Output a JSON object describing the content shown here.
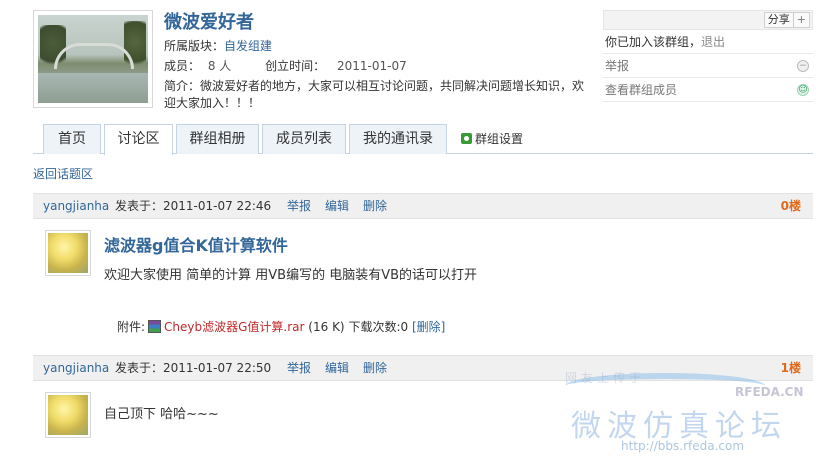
{
  "group": {
    "title": "微波爱好者",
    "section_label": "所属版块：",
    "section_value": "自发组建",
    "members_label": "成员：",
    "members_value": "8 人",
    "created_label": "创立时间：",
    "created_value": "2011-01-07",
    "intro": "简介：微波爱好者的地方，大家可以相互讨论问题，共同解决问题增长知识，欢迎大家加入！！！"
  },
  "sidebar": {
    "share_label": "分享",
    "share_plus": "+",
    "joined_text": "你已加入该群组，",
    "exit_label": "退出",
    "report_label": "举报",
    "view_members_label": "查看群组成员"
  },
  "tabs": [
    {
      "label": "首页"
    },
    {
      "label": "讨论区"
    },
    {
      "label": "群组相册"
    },
    {
      "label": "成员列表"
    },
    {
      "label": "我的通讯录"
    }
  ],
  "tab_settings_label": "群组设置",
  "back_link": "返回话题区",
  "posts": [
    {
      "author": "yangjianha",
      "meta": "发表于：2011-01-07 22:46",
      "report": "举报",
      "edit": "编辑",
      "delete": "删除",
      "floor": "0楼",
      "title": "滤波器g值合K值计算软件",
      "text": "欢迎大家使用  简单的计算  用VB编写的  电脑装有VB的话可以打开",
      "attachment": {
        "label": "附件:",
        "name": "Cheyb滤波器G值计算.rar",
        "size": "(16 K)",
        "downloads": "下载次数:0",
        "delete": "[删除]"
      }
    },
    {
      "author": "yangjianha",
      "meta": "发表于：2011-01-07 22:50",
      "report": "举报",
      "edit": "编辑",
      "delete": "删除",
      "floor": "1楼",
      "text": "自己顶下  哈哈~~~"
    }
  ],
  "watermark": {
    "faded": "网友上传于",
    "brand": "RFEDA.CN",
    "big": "微波仿真论坛",
    "url": "http://bbs.rfeda.com"
  },
  "colors": {
    "link": "#336699",
    "floor": "#e06a1b",
    "attachment": "#c0282a"
  }
}
